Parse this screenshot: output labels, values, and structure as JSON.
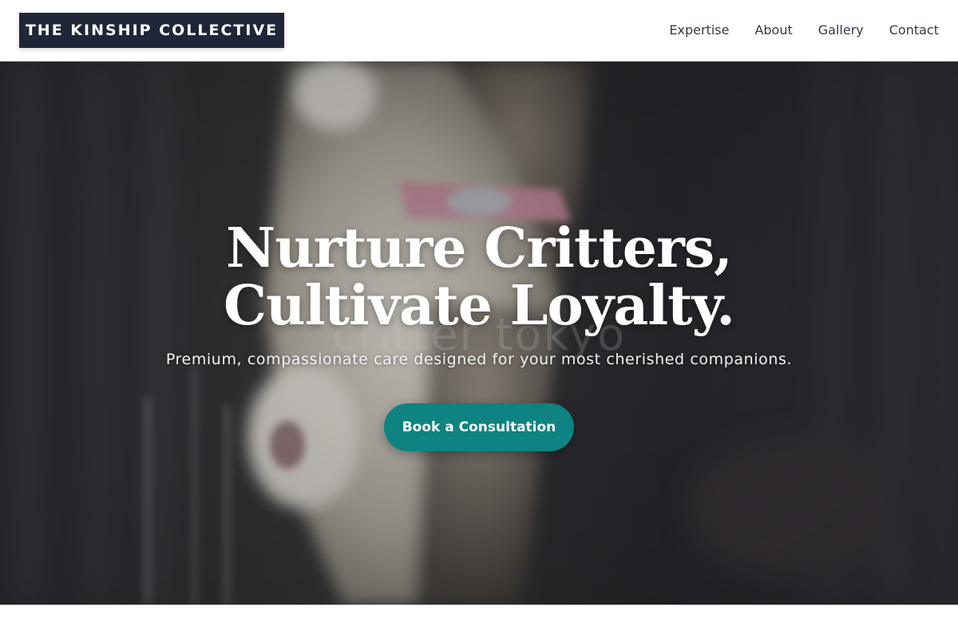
{
  "header": {
    "brand": "THE KINSHIP COLLECTIVE",
    "nav": [
      {
        "label": "Expertise"
      },
      {
        "label": "About"
      },
      {
        "label": "Gallery"
      },
      {
        "label": "Contact"
      }
    ]
  },
  "hero": {
    "title_line_1": "Nurture Critters,",
    "title_line_2": "Cultivate Loyalty.",
    "watermark": "critter tokyo",
    "subtitle": "Premium, compassionate care designed for your most cherished companions.",
    "cta_label": "Book a Consultation"
  },
  "colors": {
    "brand_bg": "#1f2637",
    "cta_bg": "#0f8282",
    "nav_text": "#333a44",
    "hero_text": "#ffffff"
  },
  "icons": {
    "hero_image": "kitten-in-cage-photo"
  }
}
